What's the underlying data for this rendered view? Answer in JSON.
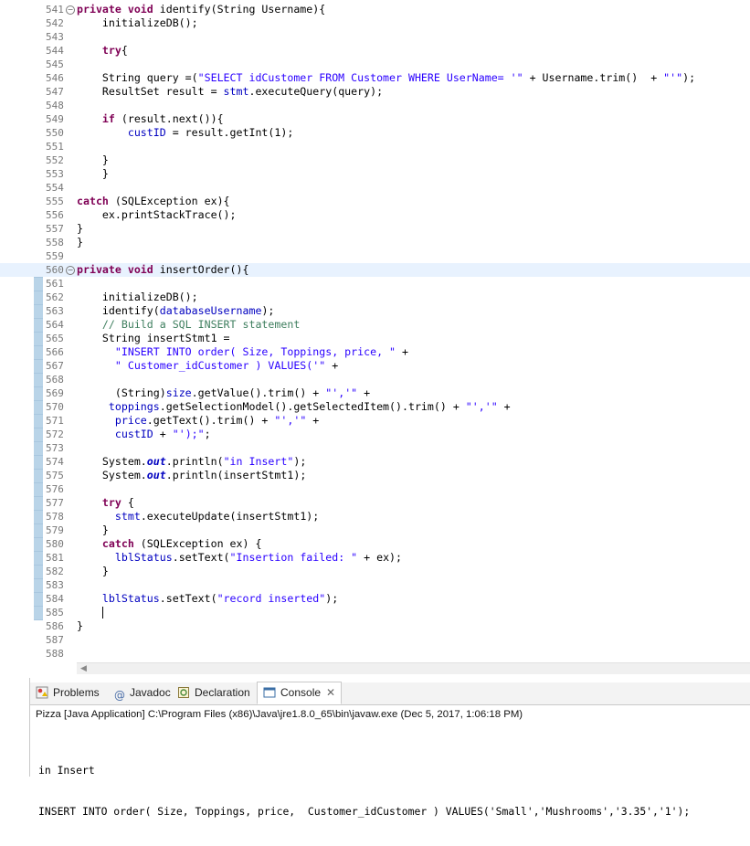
{
  "editor": {
    "lines": [
      {
        "n": "541",
        "fold": "−",
        "segs": [
          {
            "c": "kw",
            "t": "private "
          },
          {
            "c": "kw",
            "t": "void "
          },
          {
            "c": "",
            "t": "identify(String Username){"
          }
        ]
      },
      {
        "n": "542",
        "segs": [
          {
            "c": "",
            "t": "    initializeDB();"
          }
        ]
      },
      {
        "n": "543",
        "segs": []
      },
      {
        "n": "544",
        "segs": [
          {
            "c": "",
            "t": "    "
          },
          {
            "c": "kw",
            "t": "try"
          },
          {
            "c": "",
            "t": "{"
          }
        ]
      },
      {
        "n": "545",
        "segs": []
      },
      {
        "n": "546",
        "segs": [
          {
            "c": "",
            "t": "    String query =("
          },
          {
            "c": "str",
            "t": "\"SELECT idCustomer FROM Customer WHERE UserName= '\""
          },
          {
            "c": "",
            "t": " + Username.trim()  + "
          },
          {
            "c": "str",
            "t": "\"'\""
          },
          {
            "c": "",
            "t": ");"
          }
        ]
      },
      {
        "n": "547",
        "segs": [
          {
            "c": "",
            "t": "    ResultSet result = "
          },
          {
            "c": "fld",
            "t": "stmt"
          },
          {
            "c": "",
            "t": ".executeQuery(query);"
          }
        ]
      },
      {
        "n": "548",
        "segs": []
      },
      {
        "n": "549",
        "segs": [
          {
            "c": "",
            "t": "    "
          },
          {
            "c": "kw",
            "t": "if"
          },
          {
            "c": "",
            "t": " (result.next()){"
          }
        ]
      },
      {
        "n": "550",
        "segs": [
          {
            "c": "",
            "t": "        "
          },
          {
            "c": "fld",
            "t": "custID"
          },
          {
            "c": "",
            "t": " = result.getInt(1);"
          }
        ]
      },
      {
        "n": "551",
        "segs": []
      },
      {
        "n": "552",
        "segs": [
          {
            "c": "",
            "t": "    }"
          }
        ]
      },
      {
        "n": "553",
        "segs": [
          {
            "c": "",
            "t": "    }"
          }
        ]
      },
      {
        "n": "554",
        "segs": []
      },
      {
        "n": "555",
        "segs": [
          {
            "c": "kw",
            "t": "catch"
          },
          {
            "c": "",
            "t": " (SQLException ex){"
          }
        ]
      },
      {
        "n": "556",
        "segs": [
          {
            "c": "",
            "t": "    ex.printStackTrace();"
          }
        ]
      },
      {
        "n": "557",
        "segs": [
          {
            "c": "",
            "t": "}"
          }
        ]
      },
      {
        "n": "558",
        "segs": [
          {
            "c": "",
            "t": "}"
          }
        ]
      },
      {
        "n": "559",
        "segs": []
      },
      {
        "n": "560",
        "fold": "−",
        "hl": true,
        "segs": [
          {
            "c": "kw",
            "t": "private "
          },
          {
            "c": "kw",
            "t": "void "
          },
          {
            "c": "",
            "t": "insertOrder(){"
          }
        ]
      },
      {
        "n": "561",
        "segs": []
      },
      {
        "n": "562",
        "segs": [
          {
            "c": "",
            "t": "    initializeDB();"
          }
        ]
      },
      {
        "n": "563",
        "segs": [
          {
            "c": "",
            "t": "    identify("
          },
          {
            "c": "fld",
            "t": "databaseUsername"
          },
          {
            "c": "",
            "t": ");"
          }
        ]
      },
      {
        "n": "564",
        "segs": [
          {
            "c": "cmt",
            "t": "    // Build a SQL INSERT statement"
          }
        ]
      },
      {
        "n": "565",
        "segs": [
          {
            "c": "",
            "t": "    String insertStmt1 ="
          }
        ]
      },
      {
        "n": "566",
        "segs": [
          {
            "c": "",
            "t": "      "
          },
          {
            "c": "str",
            "t": "\"INSERT INTO order( Size, Toppings, price, \""
          },
          {
            "c": "",
            "t": " +"
          }
        ]
      },
      {
        "n": "567",
        "segs": [
          {
            "c": "",
            "t": "      "
          },
          {
            "c": "str",
            "t": "\" Customer_idCustomer ) VALUES('\""
          },
          {
            "c": "",
            "t": " +"
          }
        ]
      },
      {
        "n": "568",
        "segs": []
      },
      {
        "n": "569",
        "segs": [
          {
            "c": "",
            "t": "      (String)"
          },
          {
            "c": "fld",
            "t": "size"
          },
          {
            "c": "",
            "t": ".getValue().trim() + "
          },
          {
            "c": "str",
            "t": "\"','\""
          },
          {
            "c": "",
            "t": " +"
          }
        ]
      },
      {
        "n": "570",
        "segs": [
          {
            "c": "",
            "t": "     "
          },
          {
            "c": "fld",
            "t": "toppings"
          },
          {
            "c": "",
            "t": ".getSelectionModel().getSelectedItem().trim() + "
          },
          {
            "c": "str",
            "t": "\"','\""
          },
          {
            "c": "",
            "t": " +"
          }
        ]
      },
      {
        "n": "571",
        "segs": [
          {
            "c": "",
            "t": "      "
          },
          {
            "c": "fld",
            "t": "price"
          },
          {
            "c": "",
            "t": ".getText().trim() + "
          },
          {
            "c": "str",
            "t": "\"','\""
          },
          {
            "c": "",
            "t": " +"
          }
        ]
      },
      {
        "n": "572",
        "segs": [
          {
            "c": "",
            "t": "      "
          },
          {
            "c": "fld",
            "t": "custID"
          },
          {
            "c": "",
            "t": " + "
          },
          {
            "c": "str",
            "t": "\"');\""
          },
          {
            "c": "",
            "t": ";"
          }
        ]
      },
      {
        "n": "573",
        "segs": []
      },
      {
        "n": "574",
        "segs": [
          {
            "c": "",
            "t": "    System."
          },
          {
            "c": "sfld",
            "t": "out"
          },
          {
            "c": "",
            "t": ".println("
          },
          {
            "c": "str",
            "t": "\"in Insert\""
          },
          {
            "c": "",
            "t": ");"
          }
        ]
      },
      {
        "n": "575",
        "segs": [
          {
            "c": "",
            "t": "    System."
          },
          {
            "c": "sfld",
            "t": "out"
          },
          {
            "c": "",
            "t": ".println(insertStmt1);"
          }
        ]
      },
      {
        "n": "576",
        "segs": []
      },
      {
        "n": "577",
        "segs": [
          {
            "c": "",
            "t": "    "
          },
          {
            "c": "kw",
            "t": "try"
          },
          {
            "c": "",
            "t": " {"
          }
        ]
      },
      {
        "n": "578",
        "segs": [
          {
            "c": "",
            "t": "      "
          },
          {
            "c": "fld",
            "t": "stmt"
          },
          {
            "c": "",
            "t": ".executeUpdate(insertStmt1);"
          }
        ]
      },
      {
        "n": "579",
        "segs": [
          {
            "c": "",
            "t": "    }"
          }
        ]
      },
      {
        "n": "580",
        "segs": [
          {
            "c": "",
            "t": "    "
          },
          {
            "c": "kw",
            "t": "catch"
          },
          {
            "c": "",
            "t": " (SQLException ex) {"
          }
        ]
      },
      {
        "n": "581",
        "segs": [
          {
            "c": "",
            "t": "      "
          },
          {
            "c": "fld",
            "t": "lblStatus"
          },
          {
            "c": "",
            "t": ".setText("
          },
          {
            "c": "str",
            "t": "\"Insertion failed: \""
          },
          {
            "c": "",
            "t": " + ex);"
          }
        ]
      },
      {
        "n": "582",
        "segs": [
          {
            "c": "",
            "t": "    }"
          }
        ]
      },
      {
        "n": "583",
        "segs": []
      },
      {
        "n": "584",
        "segs": [
          {
            "c": "",
            "t": "    "
          },
          {
            "c": "fld",
            "t": "lblStatus"
          },
          {
            "c": "",
            "t": ".setText("
          },
          {
            "c": "str",
            "t": "\"record inserted\""
          },
          {
            "c": "",
            "t": ");"
          }
        ]
      },
      {
        "n": "585",
        "caret": true,
        "segs": [
          {
            "c": "",
            "t": "    "
          }
        ]
      },
      {
        "n": "586",
        "segs": [
          {
            "c": "",
            "t": "}"
          }
        ]
      },
      {
        "n": "587",
        "segs": []
      },
      {
        "n": "588",
        "segs": []
      }
    ]
  },
  "panel": {
    "tabs": [
      {
        "label": "Problems",
        "icon": "problems-icon",
        "active": false
      },
      {
        "label": "Javadoc",
        "icon": "javadoc-icon",
        "active": false
      },
      {
        "label": "Declaration",
        "icon": "declaration-icon",
        "active": false
      },
      {
        "label": "Console",
        "icon": "console-icon",
        "active": true
      }
    ],
    "launch_info": "Pizza [Java Application] C:\\Program Files (x86)\\Java\\jre1.8.0_65\\bin\\javaw.exe (Dec 5, 2017, 1:06:18 PM)",
    "console_lines": [
      "in Insert",
      "INSERT INTO order( Size, Toppings, price,  Customer_idCustomer ) VALUES('Small','Mushrooms','3.35','1');"
    ]
  },
  "colors": {
    "keyword": "#7f0055",
    "string": "#2a00ff",
    "field": "#0000c0",
    "comment": "#3f7f5f",
    "highlight": "#e8f2fe"
  }
}
